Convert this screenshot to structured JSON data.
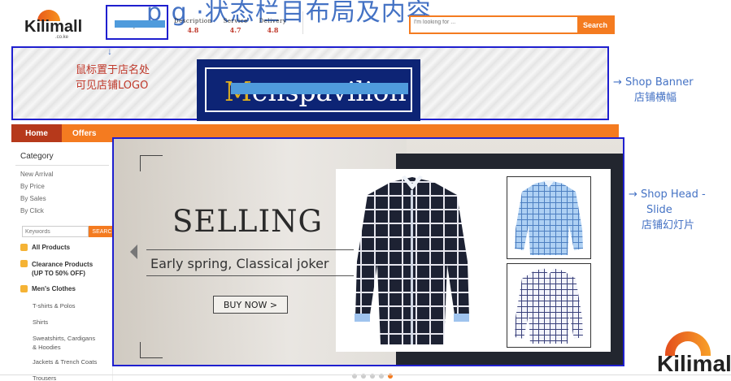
{
  "top_strip": {
    "text": "p                g         ·状态栏目布局及内容"
  },
  "header": {
    "logo_text": "Kilimall",
    "logo_sub": ".co.ke",
    "shop_name": "Menspavilion",
    "ratings": [
      {
        "label": "Description",
        "value": "4.8"
      },
      {
        "label": "Service",
        "value": "4.7"
      },
      {
        "label": "Delivery",
        "value": "4.8"
      }
    ],
    "search": {
      "placeholder": "I'm looking for ...",
      "button": "Search"
    }
  },
  "banner": {
    "arrow": "↓",
    "note_line1": "鼠标置于店名处",
    "note_line2": "可见店铺LOGO",
    "brand_first": "M",
    "brand_rest": "enspavilion"
  },
  "annotations": {
    "banner_en": "→  Shop Banner",
    "banner_cn": "店铺横幅",
    "slide_en_1": "→  Shop Head -",
    "slide_en_2": "Slide",
    "slide_cn": "店铺幻灯片"
  },
  "nav": {
    "home": "Home",
    "offers": "Offers"
  },
  "sidebar": {
    "category_title": "Category",
    "links": [
      "New Arrival",
      "By Price",
      "By Sales",
      "By Click"
    ],
    "keyword_placeholder": "Keywords",
    "keyword_button": "SEARCH",
    "all_products": "All Products",
    "clearance_line1": "Clearance Products",
    "clearance_line2": "(UP TO 50% OFF)",
    "mens_clothes": "Men's Clothes",
    "sub_items": [
      "T-shirts & Polos",
      "Shirts",
      "Sweatshirts, Cardigans",
      "& Hoodies",
      "Jackets & Trench Coats",
      "Trousers"
    ]
  },
  "slide": {
    "headline": "SELLING",
    "tagline": "Early spring,  Classical joker",
    "button": "BUY NOW >",
    "active_slide": 5,
    "slide_count": 5
  },
  "corner_logo": {
    "text": "Kilimal"
  },
  "colors": {
    "accent": "#f47b20",
    "home_tab": "#b6391b",
    "annotation_blue": "#4472c4",
    "highlight_border": "#1f1fcf",
    "note_red": "#c0392b"
  }
}
